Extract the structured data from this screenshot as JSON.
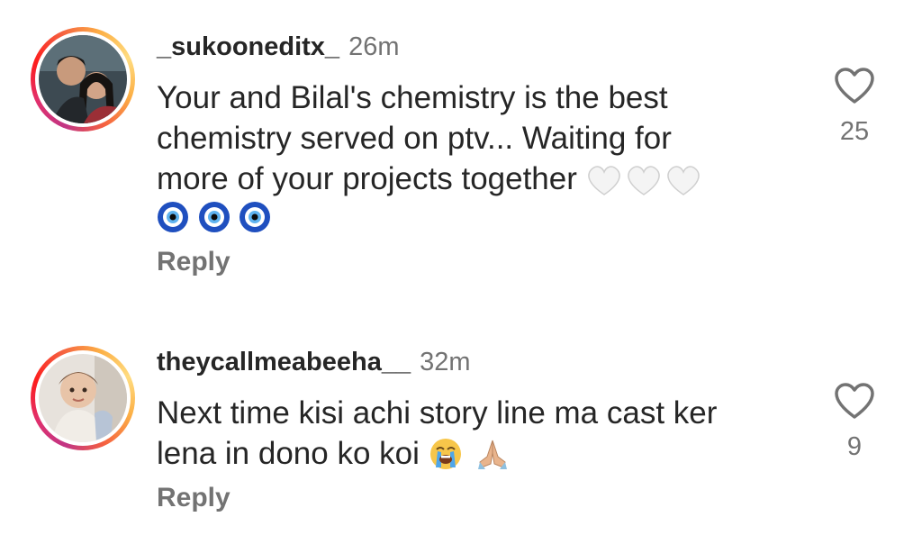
{
  "comments": [
    {
      "username": "_sukooneditx_",
      "time": "26m",
      "text_lines": [
        "Your and Bilal's chemistry is the best",
        "chemistry served on ptv... Waiting for",
        "more of your projects together"
      ],
      "trailing_emoji": [
        "white-heart",
        "white-heart",
        "white-heart"
      ],
      "extra_emoji_line": [
        "nazar-amulet",
        "nazar-amulet",
        "nazar-amulet"
      ],
      "reply_label": "Reply",
      "like_icon": "heart-outline-icon",
      "like_count": "25"
    },
    {
      "username": "theycallmeabeeha__",
      "time": "32m",
      "text_lines": [
        "Next time kisi achi story line ma cast ker",
        "lena in dono ko koi"
      ],
      "trailing_emoji": [
        "loudly-crying-face",
        "folded-hands"
      ],
      "reply_label": "Reply",
      "like_icon": "heart-outline-icon",
      "like_count": "9"
    }
  ],
  "colors": {
    "text_primary": "#262626",
    "text_secondary": "#737373",
    "story_ring_start": "#c13584",
    "story_ring_end": "#fcaf45"
  }
}
